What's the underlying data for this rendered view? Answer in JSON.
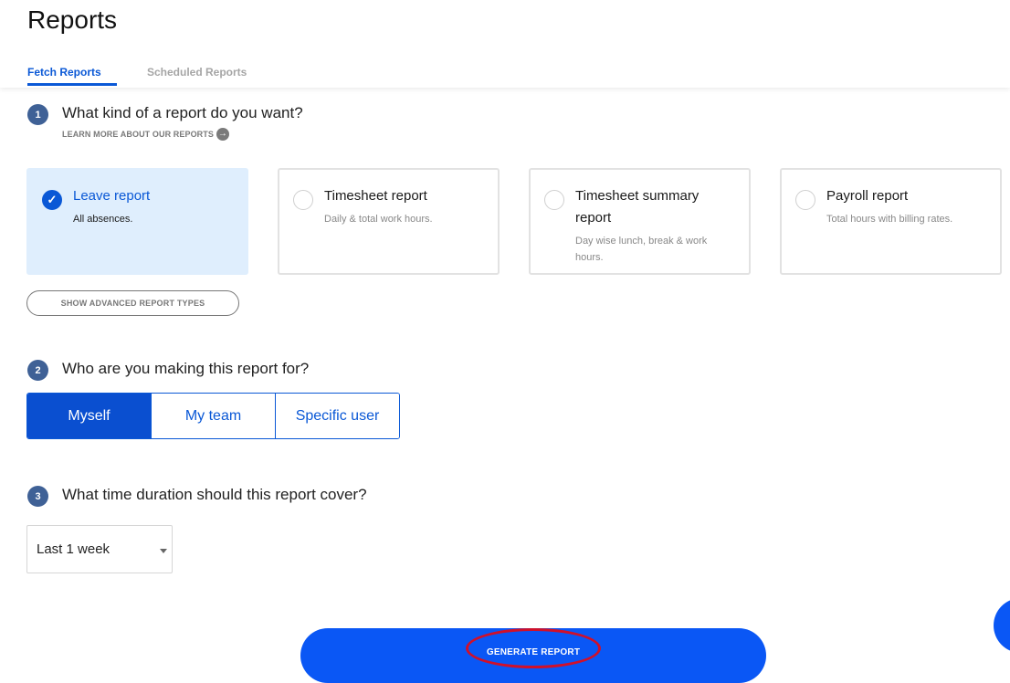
{
  "page": {
    "title": "Reports"
  },
  "tabs": [
    {
      "label": "Fetch Reports",
      "active": true
    },
    {
      "label": "Scheduled Reports",
      "active": false
    }
  ],
  "step1": {
    "number": "1",
    "question": "What kind of a report do you want?",
    "learn_more": "LEARN MORE ABOUT OUR REPORTS",
    "cards": [
      {
        "title": "Leave report",
        "desc": "All absences.",
        "selected": true
      },
      {
        "title": "Timesheet report",
        "desc": "Daily & total work hours.",
        "selected": false
      },
      {
        "title": "Timesheet summary report",
        "desc": "Day wise lunch, break & work hours.",
        "selected": false
      },
      {
        "title": "Payroll report",
        "desc": "Total hours with billing rates.",
        "selected": false
      }
    ],
    "advanced_label": "SHOW ADVANCED REPORT TYPES"
  },
  "step2": {
    "number": "2",
    "question": "Who are you making this report for?",
    "options": [
      "Myself",
      "My team",
      "Specific user"
    ],
    "selected": "Myself"
  },
  "step3": {
    "number": "3",
    "question": "What time duration should this report cover?",
    "duration_value": "Last 1 week"
  },
  "generate_label": "GENERATE REPORT",
  "colors": {
    "accent": "#0a58d6",
    "step_badge": "#3f6196",
    "selected_card_bg": "#dfeefd",
    "generate_bg": "#0a57f5",
    "annotation": "#d0102a"
  },
  "icons": {
    "check": "check-icon",
    "arrow": "arrow-right-circle-icon",
    "caret": "caret-down-icon"
  }
}
